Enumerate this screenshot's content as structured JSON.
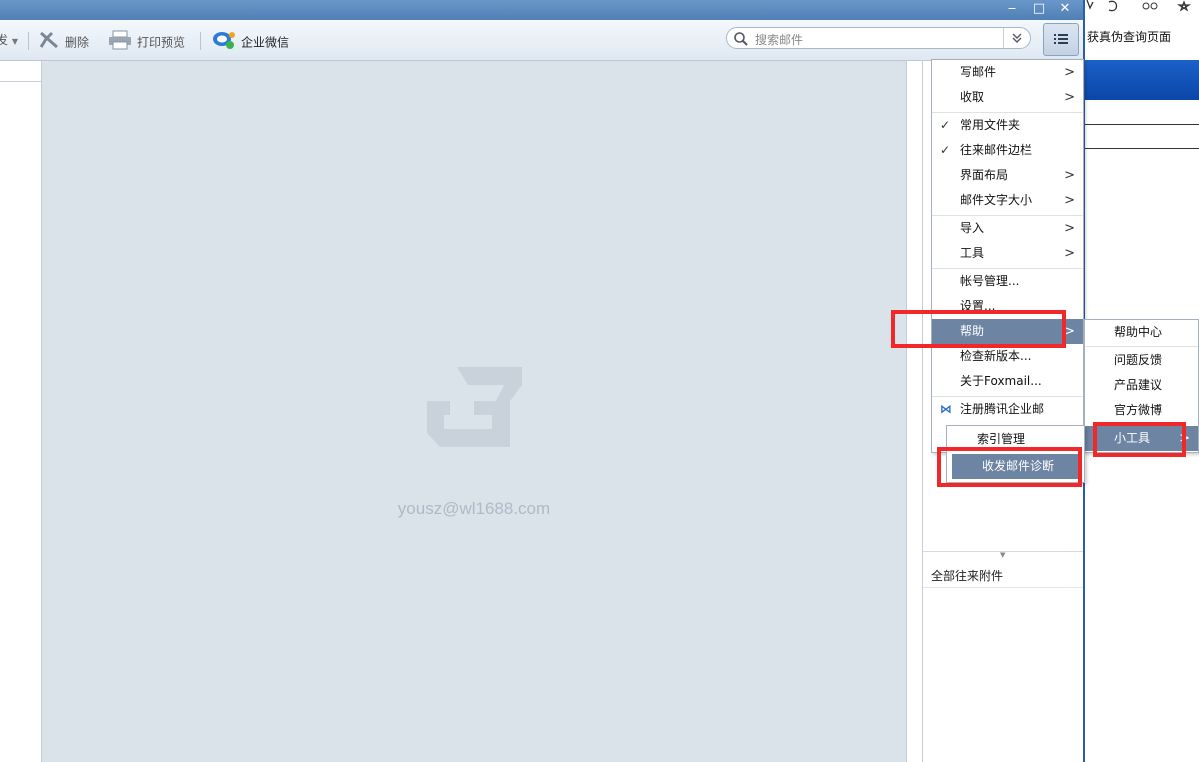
{
  "toolbar": {
    "cut_label": "发",
    "delete_label": "删除",
    "print_label": "打印预览",
    "wechat_label": "企业微信",
    "search_placeholder": "搜索邮件"
  },
  "main": {
    "account": "yousz@wl1688.com"
  },
  "sidebar": {
    "attachments_label": "全部往来附件"
  },
  "browser": {
    "title": "获真伪查询页面"
  },
  "main_menu": {
    "items": [
      {
        "label": "写邮件"
      },
      {
        "label": "收取"
      },
      {
        "label": "常用文件夹",
        "checked": true
      },
      {
        "label": "往来邮件边栏",
        "checked": true
      },
      {
        "label": "界面布局"
      },
      {
        "label": "邮件文字大小"
      },
      {
        "label": "导入"
      },
      {
        "label": "工具"
      },
      {
        "label": "帐号管理..."
      },
      {
        "label": "设置..."
      },
      {
        "label": "帮助",
        "highlighted": true
      },
      {
        "label": "检查新版本..."
      },
      {
        "label": "关于Foxmail..."
      },
      {
        "label": "注册腾讯企业邮"
      }
    ]
  },
  "help_menu": {
    "items": [
      {
        "label": "帮助中心"
      },
      {
        "label": "问题反馈"
      },
      {
        "label": "产品建议"
      },
      {
        "label": "官方微博"
      },
      {
        "label": "小工具",
        "highlighted": true
      }
    ]
  },
  "tools_menu": {
    "items": [
      {
        "label": "索引管理"
      },
      {
        "label": "收发邮件诊断",
        "highlighted": true
      }
    ]
  },
  "colors": {
    "highlight": "#6d84a3",
    "annotation": "#f0282a",
    "brand_blue": "#4f7fb7"
  }
}
